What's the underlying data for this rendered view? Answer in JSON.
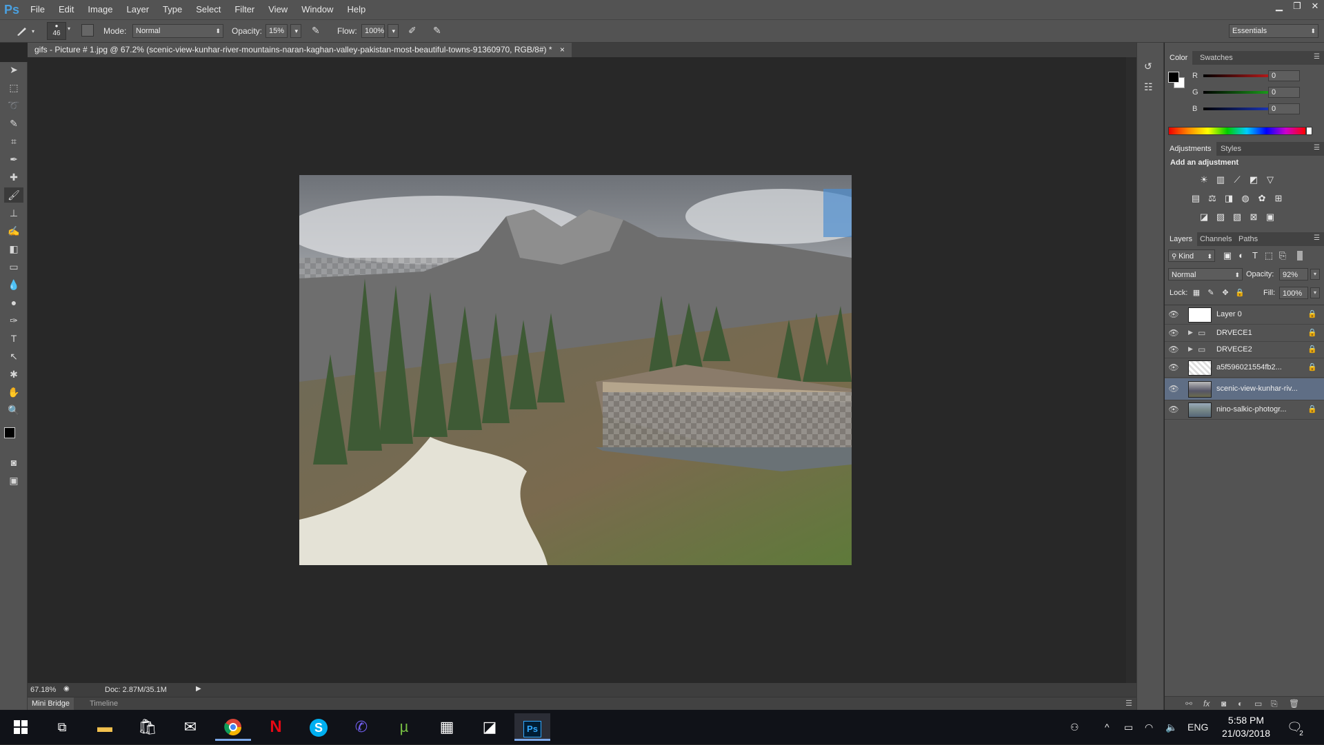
{
  "app": {
    "logo": "Ps"
  },
  "menu": [
    "File",
    "Edit",
    "Image",
    "Layer",
    "Type",
    "Select",
    "Filter",
    "View",
    "Window",
    "Help"
  ],
  "window_controls": {
    "minimize": "▁",
    "restore": "❐",
    "close": "✕"
  },
  "options": {
    "brush_size": "46",
    "mode_label": "Mode:",
    "mode_value": "Normal",
    "opacity_label": "Opacity:",
    "opacity_value": "15%",
    "flow_label": "Flow:",
    "flow_value": "100%",
    "workspace": "Essentials"
  },
  "document": {
    "tab_title": "gifs - Picture # 1.jpg @ 67.2% (scenic-view-kunhar-river-mountains-naran-kaghan-valley-pakistan-most-beautiful-towns-91360970, RGB/8#) *",
    "close": "×",
    "zoom": "67.18%",
    "doc_info": "Doc: 2.87M/35.1M"
  },
  "bottom_tabs": [
    "Mini Bridge",
    "Timeline"
  ],
  "color_panel": {
    "tabs": [
      "Color",
      "Swatches"
    ],
    "channels": [
      {
        "label": "R",
        "value": "0",
        "color": "#e02020"
      },
      {
        "label": "G",
        "value": "0",
        "color": "#20c020"
      },
      {
        "label": "B",
        "value": "0",
        "color": "#2040e0"
      }
    ]
  },
  "adjustments_panel": {
    "tabs": [
      "Adjustments",
      "Styles"
    ],
    "heading": "Add an adjustment",
    "icons": [
      "brightness-icon",
      "levels-icon",
      "curves-icon",
      "exposure-icon",
      "vibrance-icon",
      "hue-saturation-icon",
      "color-balance-icon",
      "black-white-icon",
      "photo-filter-icon",
      "channel-mixer-icon",
      "color-lookup-icon",
      "invert-icon",
      "posterize-icon",
      "threshold-icon",
      "gradient-map-icon",
      "selective-color-icon"
    ]
  },
  "layers_panel": {
    "tabs": [
      "Layers",
      "Channels",
      "Paths"
    ],
    "kind_label": "Kind",
    "blend_mode": "Normal",
    "opacity_label": "Opacity:",
    "opacity_value": "92%",
    "lock_label": "Lock:",
    "fill_label": "Fill:",
    "fill_value": "100%",
    "layers": [
      {
        "name": "Layer 0",
        "type": "layer",
        "selected": false
      },
      {
        "name": "DRVECE1",
        "type": "group",
        "selected": false
      },
      {
        "name": "DRVECE2",
        "type": "group",
        "selected": false
      },
      {
        "name": "a5f596021554fb2...",
        "type": "layer",
        "selected": false
      },
      {
        "name": "scenic-view-kunhar-riv...",
        "type": "layer",
        "selected": true
      },
      {
        "name": "nino-salkic-photogr...",
        "type": "layer",
        "selected": false
      }
    ]
  },
  "taskbar": {
    "apps": [
      "start-icon",
      "task-view-icon",
      "file-explorer-icon",
      "store-icon",
      "mail-icon",
      "chrome-icon",
      "netflix-icon",
      "skype-icon",
      "viber-icon",
      "utorrent-icon",
      "calculator-icon",
      "sticky-notes-icon",
      "photoshop-icon"
    ],
    "netflix_letter": "N",
    "skype_letter": "S",
    "ps_letter": "Ps",
    "language": "ENG",
    "time": "5:58 PM",
    "date": "21/03/2018",
    "notifications": "2"
  }
}
